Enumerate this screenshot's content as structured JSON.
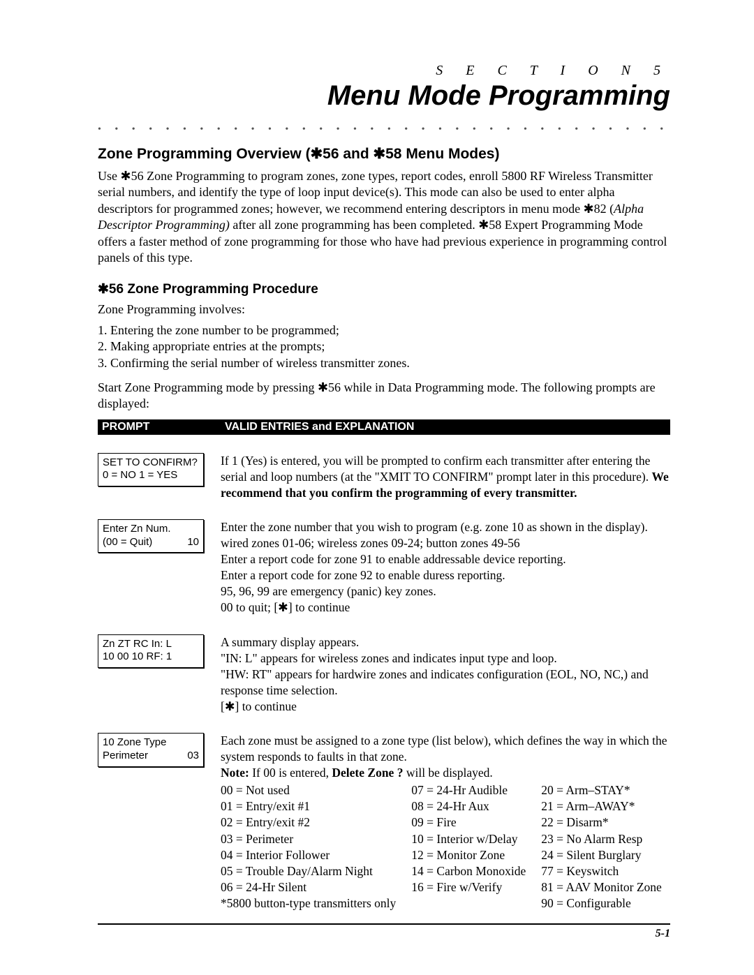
{
  "section_label": "S E C T I O N  5",
  "title": "Menu Mode Programming",
  "heading1": "Zone Programming Overview (✱56 and ✱58 Menu Modes)",
  "para1a": "Use ✱56 Zone Programming to program zones, zone types, report codes, enroll 5800 RF Wireless Transmitter serial numbers, and identify the type of loop input device(s). This mode can also be used to enter alpha descriptors for programmed zones; however, we recommend entering descriptors in menu mode ✱82 (",
  "para1_italic": "Alpha Descriptor Programming)",
  "para1b": " after all zone programming has been completed. ✱58 Expert Programming Mode offers a faster method of zone programming for those who have had previous experience in programming control panels of this type.",
  "heading2": "✱56 Zone Programming Procedure",
  "para2": "Zone Programming involves:",
  "li1": "1.  Entering the zone number to be programmed;",
  "li2": "2.  Making appropriate entries at the prompts;",
  "li3": "3.  Confirming the serial number of wireless transmitter zones.",
  "para3": "Start Zone Programming mode by pressing ✱56 while in Data Programming mode. The following prompts are displayed:",
  "th_prompt": "PROMPT",
  "th_valid": "VALID ENTRIES and EXPLANATION",
  "rows": [
    {
      "lcd_l1": "SET TO CONFIRM?",
      "lcd_l2a": "0 = NO  1 = YES",
      "lcd_l2b": "",
      "desc_a": "If 1 (Yes) is entered, you will be prompted to confirm each transmitter after entering the serial and loop numbers (at the \"XMIT TO CONFIRM\" prompt later in this procedure).  ",
      "desc_bold": "We recommend that you confirm the programming of every transmitter.",
      "desc_b": ""
    },
    {
      "lcd_l1": "Enter Zn Num.",
      "lcd_l2a": "(00 = Quit)",
      "lcd_l2b": "10",
      "desc_a": "Enter the zone number that you wish to program (e.g. zone 10 as shown in the display). wired zones 01-06; wireless zones 09-24; button zones 49-56\nEnter a report code for zone 91 to enable addressable device reporting.\nEnter a report code for zone 92 to enable duress reporting.\n95, 96, 99 are emergency (panic) key zones.\n00 to quit; [✱] to continue",
      "desc_bold": "",
      "desc_b": ""
    },
    {
      "lcd_l1": "Zn  ZT  RC    In:   L",
      "lcd_l2a": "10  00  10   RF:   1",
      "lcd_l2b": "",
      "desc_a": "A summary display appears.\n\"IN: L\" appears for wireless zones and indicates input type and loop.\n \"HW: RT\" appears for hardwire zones and indicates configuration (EOL, NO, NC,) and response time selection.\n[✱] to continue",
      "desc_bold": "",
      "desc_b": ""
    },
    {
      "lcd_l1": "10 Zone Type",
      "lcd_l2a": "Perimeter",
      "lcd_l2b": "03",
      "desc_a": "Each zone must be assigned to a zone type (list below), which defines the way in which the system responds to faults in that zone.\n",
      "desc_bold": "Note:",
      "desc_b": " If 00 is entered, ",
      "desc_bold2": "Delete Zone ?",
      "desc_c": " will be displayed."
    }
  ],
  "zone_types": {
    "col1": "00 = Not used\n01 = Entry/exit #1\n02 = Entry/exit #2\n03 = Perimeter\n04 = Interior Follower\n05 = Trouble Day/Alarm Night\n06 = 24-Hr Silent\n*5800 button-type transmitters only",
    "col2": "07 = 24-Hr Audible\n08 = 24-Hr Aux\n09 = Fire\n10 = Interior w/Delay\n12 = Monitor Zone\n14 = Carbon Monoxide\n16 = Fire w/Verify",
    "col3": "20 = Arm–STAY*\n21 = Arm–AWAY*\n22 = Disarm*\n23 = No Alarm Resp\n24 = Silent Burglary\n77 = Keyswitch\n81 = AAV Monitor Zone\n90 = Configurable"
  },
  "page_num": "5-1"
}
